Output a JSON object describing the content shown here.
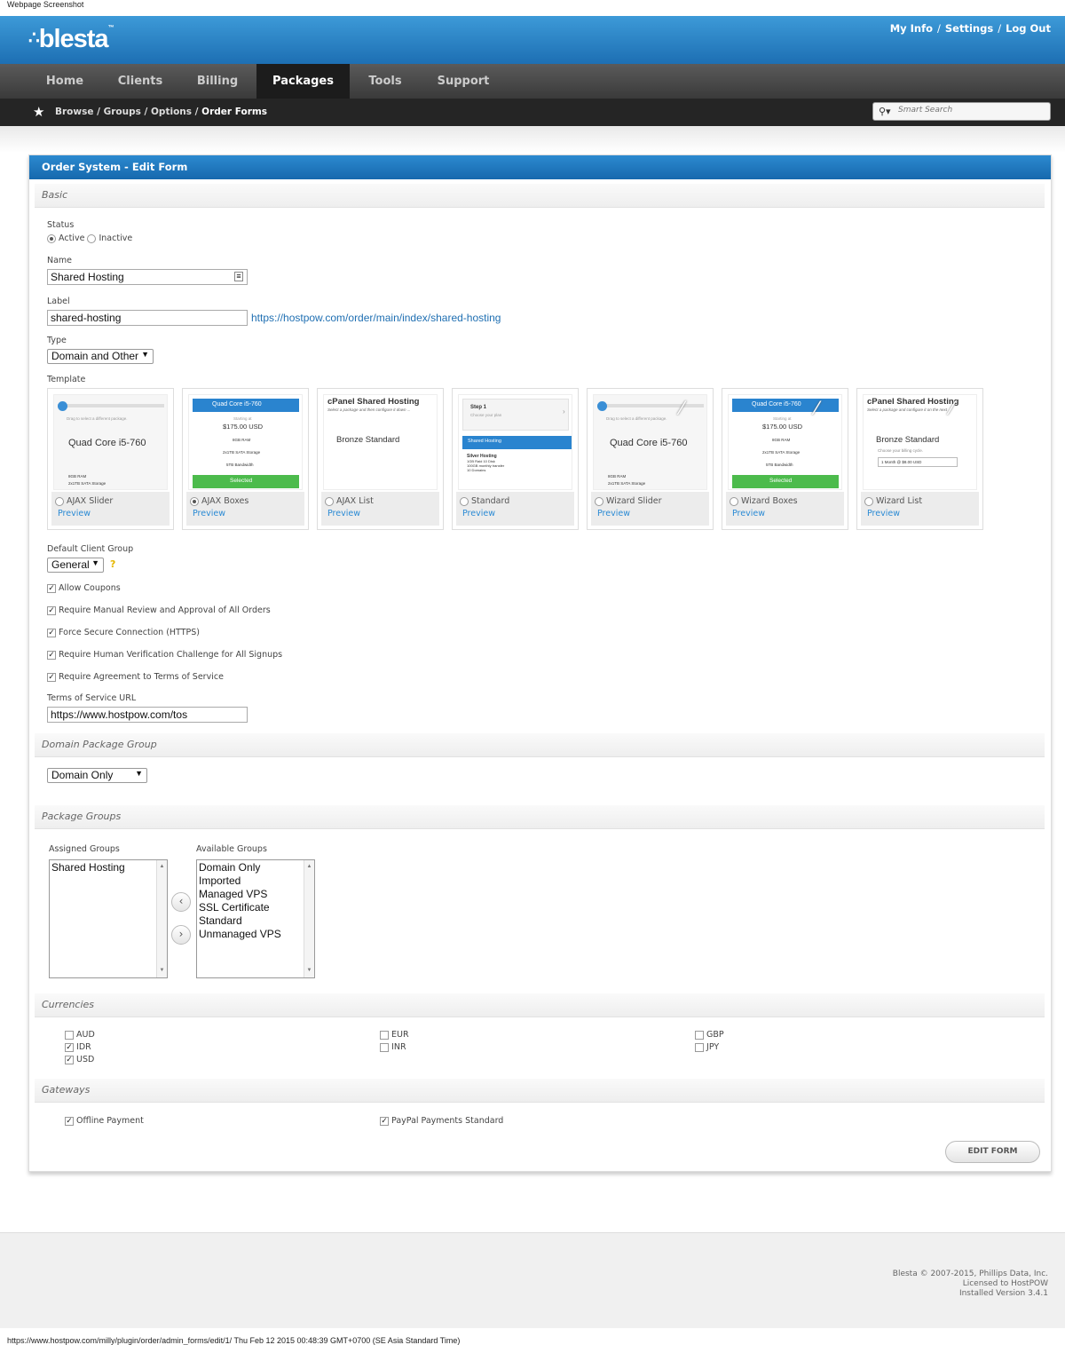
{
  "screenshot_caption": "Webpage Screenshot",
  "app": {
    "logo": "blesta",
    "logo_tm": "™"
  },
  "top_links": {
    "my_info": "My Info",
    "settings": "Settings",
    "log_out": "Log Out",
    "sep": "/"
  },
  "nav": [
    "Home",
    "Clients",
    "Billing",
    "Packages",
    "Tools",
    "Support"
  ],
  "breadcrumb": {
    "trail": "Browse / Groups / Options /",
    "current": "Order Forms"
  },
  "search": {
    "placeholder": "Smart Search"
  },
  "panel": {
    "title": "Order System - Edit Form",
    "sections": {
      "basic": "Basic",
      "domain_group": "Domain Package Group",
      "package_groups": "Package Groups",
      "currencies": "Currencies",
      "gateways": "Gateways"
    },
    "status": {
      "label": "Status",
      "active": "Active",
      "inactive": "Inactive"
    },
    "name": {
      "label": "Name",
      "value": "Shared Hosting"
    },
    "label_field": {
      "label": "Label",
      "value": "shared-hosting",
      "url": "https://hostpow.com/order/main/index/shared-hosting"
    },
    "type": {
      "label": "Type",
      "value": "Domain and Other"
    },
    "template": {
      "label": "Template",
      "preview_label": "Preview",
      "items": [
        {
          "name": "AJAX Slider",
          "selected": false,
          "sample_title": "Quad Core i5-760",
          "hint": "Drag to select a different package.",
          "specs": [
            "8GB RAM",
            "2x1TB SATA Storage"
          ]
        },
        {
          "name": "AJAX Boxes",
          "selected": true,
          "sample_title": "Quad Core i5-760",
          "hint": "Starting at",
          "price": "$175.00 USD",
          "specs": [
            "8GB RAM",
            "2x1TB SATA Storage",
            "5TB Bandwidth"
          ],
          "button": "Selected"
        },
        {
          "name": "AJAX List",
          "selected": false,
          "sample_title": "cPanel Shared Hosting",
          "hint": "Select a package and then configure it down ...",
          "specs": [
            "Bronze Standard"
          ]
        },
        {
          "name": "Standard",
          "selected": false,
          "sample_title": "Step 1",
          "hint": "Choose your plan",
          "price": "Shared Hosting",
          "specs": [
            "Silver Hosting",
            "1GB Raid 10 Disk",
            "100GB monthly transfer",
            "10 Domains"
          ]
        },
        {
          "name": "Wizard Slider",
          "selected": false,
          "sample_title": "Quad Core i5-760",
          "hint": "Drag to select a different package.",
          "specs": [
            "8GB RAM",
            "2x1TB SATA Storage"
          ]
        },
        {
          "name": "Wizard Boxes",
          "selected": false,
          "sample_title": "Quad Core i5-760",
          "hint": "Starting at",
          "price": "$175.00 USD",
          "specs": [
            "8GB RAM",
            "2x1TB SATA Storage",
            "5TB Bandwidth"
          ],
          "button": "Selected"
        },
        {
          "name": "Wizard List",
          "selected": false,
          "sample_title": "cPanel Shared Hosting",
          "hint": "Select a package and configure it on the next",
          "specs": [
            "Bronze Standard",
            "Choose your billing cycle.",
            "1 Month @ $8.00 USD"
          ]
        }
      ]
    },
    "client_group": {
      "label": "Default Client Group",
      "value": "General",
      "help": "?"
    },
    "options": [
      {
        "label": "Allow Coupons",
        "checked": true
      },
      {
        "label": "Require Manual Review and Approval of All Orders",
        "checked": true
      },
      {
        "label": "Force Secure Connection (HTTPS)",
        "checked": true
      },
      {
        "label": "Require Human Verification Challenge for All Signups",
        "checked": true
      },
      {
        "label": "Require Agreement to Terms of Service",
        "checked": true
      }
    ],
    "tos": {
      "label": "Terms of Service URL",
      "value": "https://www.hostpow.com/tos"
    },
    "domain_group_value": "Domain Only",
    "groups": {
      "assigned_label": "Assigned Groups",
      "available_label": "Available Groups",
      "assigned": [
        "Shared Hosting"
      ],
      "available": [
        "Domain Only",
        "Imported",
        "Managed VPS",
        "SSL Certificate",
        "Standard",
        "Unmanaged VPS"
      ],
      "move_left": "‹",
      "move_right": "›"
    },
    "currencies": [
      {
        "code": "AUD",
        "checked": false
      },
      {
        "code": "IDR",
        "checked": true
      },
      {
        "code": "USD",
        "checked": true
      },
      {
        "code": "EUR",
        "checked": false
      },
      {
        "code": "INR",
        "checked": false
      },
      {
        "code": "GBP",
        "checked": false
      },
      {
        "code": "JPY",
        "checked": false
      }
    ],
    "gateways": [
      {
        "name": "Offline Payment",
        "checked": true
      },
      {
        "name": "PayPal Payments Standard",
        "checked": true
      }
    ],
    "submit": "EDIT FORM"
  },
  "footer": {
    "line1": "Blesta © 2007-2015, Phillips Data, Inc.",
    "line2": "Licensed to HostPOW",
    "line3": "Installed Version 3.4.1"
  },
  "status_bar": "https://www.hostpow.com/milly/plugin/order/admin_forms/edit/1/ Thu Feb 12 2015 00:48:39 GMT+0700 (SE Asia Standard Time)",
  "colors": {
    "brand_blue": "#1d6fb3",
    "nav_dark": "#3a3a3a",
    "selected_green": "#4cbb4c",
    "link": "#1f6fb2"
  }
}
